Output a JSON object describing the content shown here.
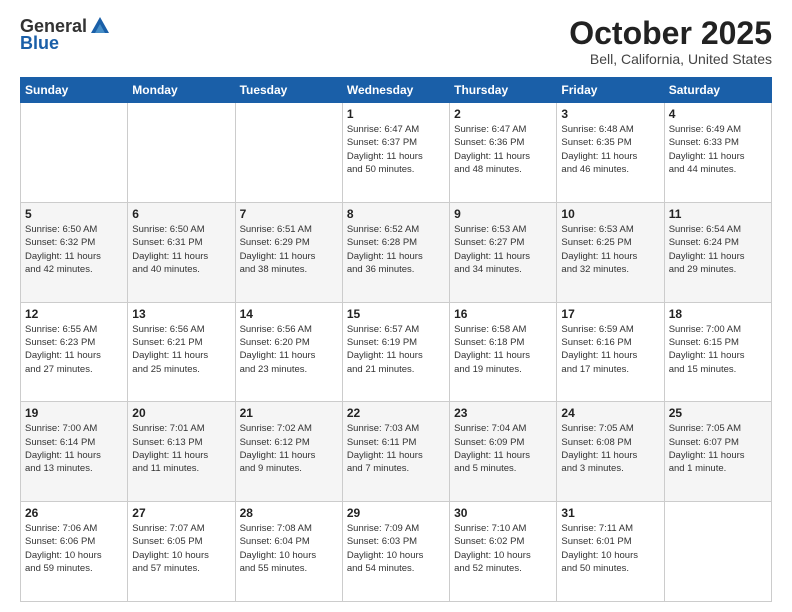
{
  "header": {
    "logo_general": "General",
    "logo_blue": "Blue",
    "title": "October 2025",
    "subtitle": "Bell, California, United States"
  },
  "days_of_week": [
    "Sunday",
    "Monday",
    "Tuesday",
    "Wednesday",
    "Thursday",
    "Friday",
    "Saturday"
  ],
  "weeks": [
    [
      {
        "num": "",
        "info": ""
      },
      {
        "num": "",
        "info": ""
      },
      {
        "num": "",
        "info": ""
      },
      {
        "num": "1",
        "info": "Sunrise: 6:47 AM\nSunset: 6:37 PM\nDaylight: 11 hours\nand 50 minutes."
      },
      {
        "num": "2",
        "info": "Sunrise: 6:47 AM\nSunset: 6:36 PM\nDaylight: 11 hours\nand 48 minutes."
      },
      {
        "num": "3",
        "info": "Sunrise: 6:48 AM\nSunset: 6:35 PM\nDaylight: 11 hours\nand 46 minutes."
      },
      {
        "num": "4",
        "info": "Sunrise: 6:49 AM\nSunset: 6:33 PM\nDaylight: 11 hours\nand 44 minutes."
      }
    ],
    [
      {
        "num": "5",
        "info": "Sunrise: 6:50 AM\nSunset: 6:32 PM\nDaylight: 11 hours\nand 42 minutes."
      },
      {
        "num": "6",
        "info": "Sunrise: 6:50 AM\nSunset: 6:31 PM\nDaylight: 11 hours\nand 40 minutes."
      },
      {
        "num": "7",
        "info": "Sunrise: 6:51 AM\nSunset: 6:29 PM\nDaylight: 11 hours\nand 38 minutes."
      },
      {
        "num": "8",
        "info": "Sunrise: 6:52 AM\nSunset: 6:28 PM\nDaylight: 11 hours\nand 36 minutes."
      },
      {
        "num": "9",
        "info": "Sunrise: 6:53 AM\nSunset: 6:27 PM\nDaylight: 11 hours\nand 34 minutes."
      },
      {
        "num": "10",
        "info": "Sunrise: 6:53 AM\nSunset: 6:25 PM\nDaylight: 11 hours\nand 32 minutes."
      },
      {
        "num": "11",
        "info": "Sunrise: 6:54 AM\nSunset: 6:24 PM\nDaylight: 11 hours\nand 29 minutes."
      }
    ],
    [
      {
        "num": "12",
        "info": "Sunrise: 6:55 AM\nSunset: 6:23 PM\nDaylight: 11 hours\nand 27 minutes."
      },
      {
        "num": "13",
        "info": "Sunrise: 6:56 AM\nSunset: 6:21 PM\nDaylight: 11 hours\nand 25 minutes."
      },
      {
        "num": "14",
        "info": "Sunrise: 6:56 AM\nSunset: 6:20 PM\nDaylight: 11 hours\nand 23 minutes."
      },
      {
        "num": "15",
        "info": "Sunrise: 6:57 AM\nSunset: 6:19 PM\nDaylight: 11 hours\nand 21 minutes."
      },
      {
        "num": "16",
        "info": "Sunrise: 6:58 AM\nSunset: 6:18 PM\nDaylight: 11 hours\nand 19 minutes."
      },
      {
        "num": "17",
        "info": "Sunrise: 6:59 AM\nSunset: 6:16 PM\nDaylight: 11 hours\nand 17 minutes."
      },
      {
        "num": "18",
        "info": "Sunrise: 7:00 AM\nSunset: 6:15 PM\nDaylight: 11 hours\nand 15 minutes."
      }
    ],
    [
      {
        "num": "19",
        "info": "Sunrise: 7:00 AM\nSunset: 6:14 PM\nDaylight: 11 hours\nand 13 minutes."
      },
      {
        "num": "20",
        "info": "Sunrise: 7:01 AM\nSunset: 6:13 PM\nDaylight: 11 hours\nand 11 minutes."
      },
      {
        "num": "21",
        "info": "Sunrise: 7:02 AM\nSunset: 6:12 PM\nDaylight: 11 hours\nand 9 minutes."
      },
      {
        "num": "22",
        "info": "Sunrise: 7:03 AM\nSunset: 6:11 PM\nDaylight: 11 hours\nand 7 minutes."
      },
      {
        "num": "23",
        "info": "Sunrise: 7:04 AM\nSunset: 6:09 PM\nDaylight: 11 hours\nand 5 minutes."
      },
      {
        "num": "24",
        "info": "Sunrise: 7:05 AM\nSunset: 6:08 PM\nDaylight: 11 hours\nand 3 minutes."
      },
      {
        "num": "25",
        "info": "Sunrise: 7:05 AM\nSunset: 6:07 PM\nDaylight: 11 hours\nand 1 minute."
      }
    ],
    [
      {
        "num": "26",
        "info": "Sunrise: 7:06 AM\nSunset: 6:06 PM\nDaylight: 10 hours\nand 59 minutes."
      },
      {
        "num": "27",
        "info": "Sunrise: 7:07 AM\nSunset: 6:05 PM\nDaylight: 10 hours\nand 57 minutes."
      },
      {
        "num": "28",
        "info": "Sunrise: 7:08 AM\nSunset: 6:04 PM\nDaylight: 10 hours\nand 55 minutes."
      },
      {
        "num": "29",
        "info": "Sunrise: 7:09 AM\nSunset: 6:03 PM\nDaylight: 10 hours\nand 54 minutes."
      },
      {
        "num": "30",
        "info": "Sunrise: 7:10 AM\nSunset: 6:02 PM\nDaylight: 10 hours\nand 52 minutes."
      },
      {
        "num": "31",
        "info": "Sunrise: 7:11 AM\nSunset: 6:01 PM\nDaylight: 10 hours\nand 50 minutes."
      },
      {
        "num": "",
        "info": ""
      }
    ]
  ]
}
